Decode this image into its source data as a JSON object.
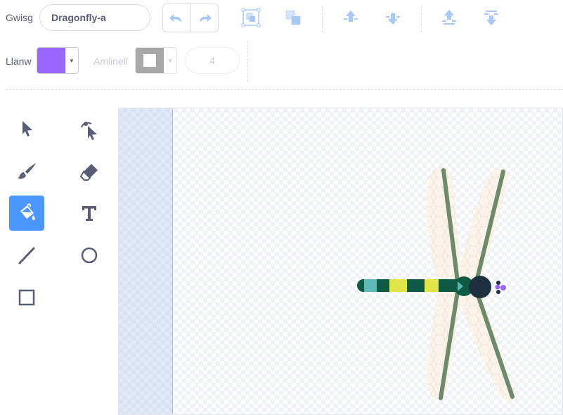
{
  "costume": {
    "label": "Gwisg",
    "name": "Dragonfly-a"
  },
  "toolbar": {
    "undo": "undo-icon",
    "redo": "redo-icon",
    "group": "group-icon",
    "ungroup": "ungroup-icon",
    "forward": "forward-icon",
    "backward": "backward-icon",
    "front": "front-icon",
    "back": "back-icon"
  },
  "fill": {
    "label": "Llanw",
    "color": "#9966ff"
  },
  "outline": {
    "label": "Amlinell",
    "width": "4"
  },
  "tools": [
    "select",
    "reshape",
    "brush",
    "eraser",
    "fill",
    "text",
    "line",
    "circle",
    "rect"
  ],
  "active_tool": "fill",
  "colors": {
    "accent": "#4c97ff",
    "tool_icon": "#575e75"
  }
}
